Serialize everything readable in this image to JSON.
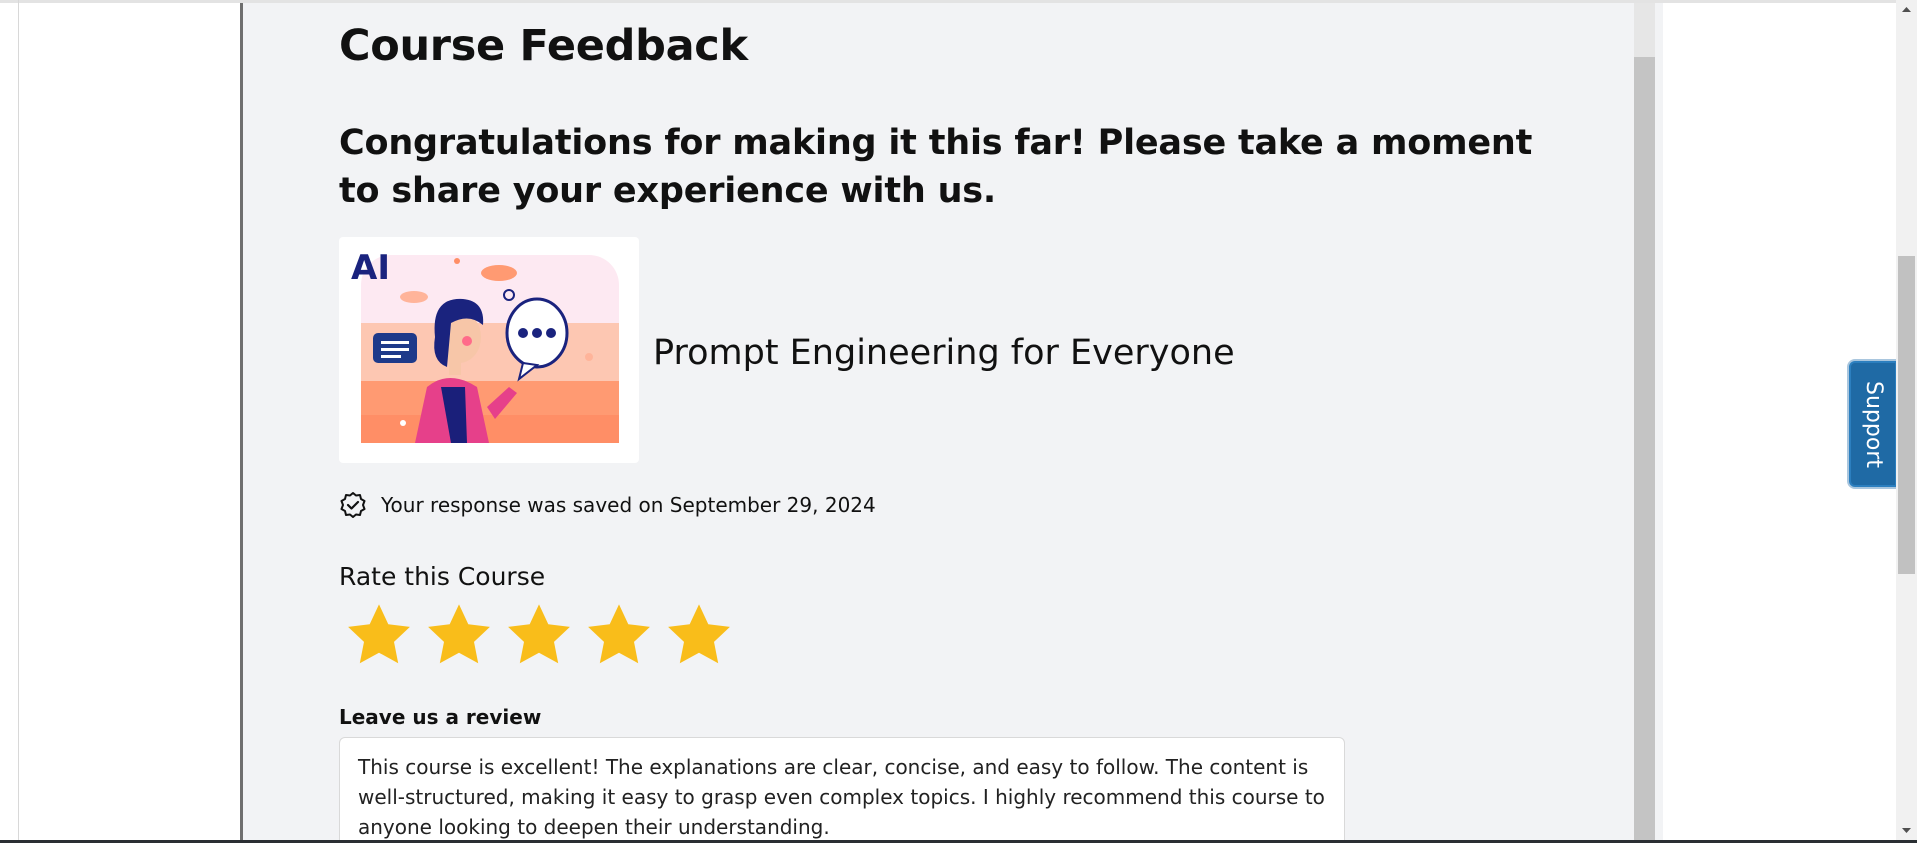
{
  "page": {
    "title": "Course Feedback",
    "congrats": "Congratulations for making it this far! Please take a moment to share your experience with us."
  },
  "course": {
    "name": "Prompt Engineering for Everyone",
    "thumbnail_text": "AI"
  },
  "status": {
    "saved_text": "Your response was saved on September 29, 2024",
    "icon": "check-badge-icon"
  },
  "rating": {
    "label": "Rate this Course",
    "value": 5,
    "max": 5,
    "star_color": "#f9bd1a"
  },
  "review": {
    "label": "Leave us a review",
    "text": "This course is excellent! The explanations are clear, concise, and easy to follow. The content is well-structured, making it easy to grasp even complex topics. I highly recommend this course to anyone looking to deepen their understanding."
  },
  "support": {
    "label": "Support",
    "color": "#1f6aa5"
  }
}
